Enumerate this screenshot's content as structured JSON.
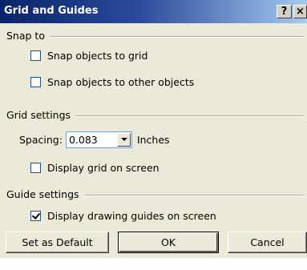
{
  "window": {
    "title": "Grid and Guides",
    "help_glyph": "?",
    "close_glyph": "×"
  },
  "snap": {
    "group_label": "Snap to",
    "options": [
      {
        "label": "Snap objects to grid",
        "checked": false
      },
      {
        "label": "Snap objects to other objects",
        "checked": false
      }
    ]
  },
  "grid": {
    "group_label": "Grid settings",
    "spacing_label": "Spacing:",
    "spacing_value": "0.083",
    "spacing_unit": "Inches",
    "display_grid_label": "Display grid on screen",
    "display_grid_checked": false
  },
  "guides": {
    "group_label": "Guide settings",
    "display_guides_label": "Display drawing guides on screen",
    "display_guides_checked": true
  },
  "buttons": {
    "set_default": "Set as Default",
    "ok": "OK",
    "cancel": "Cancel"
  }
}
